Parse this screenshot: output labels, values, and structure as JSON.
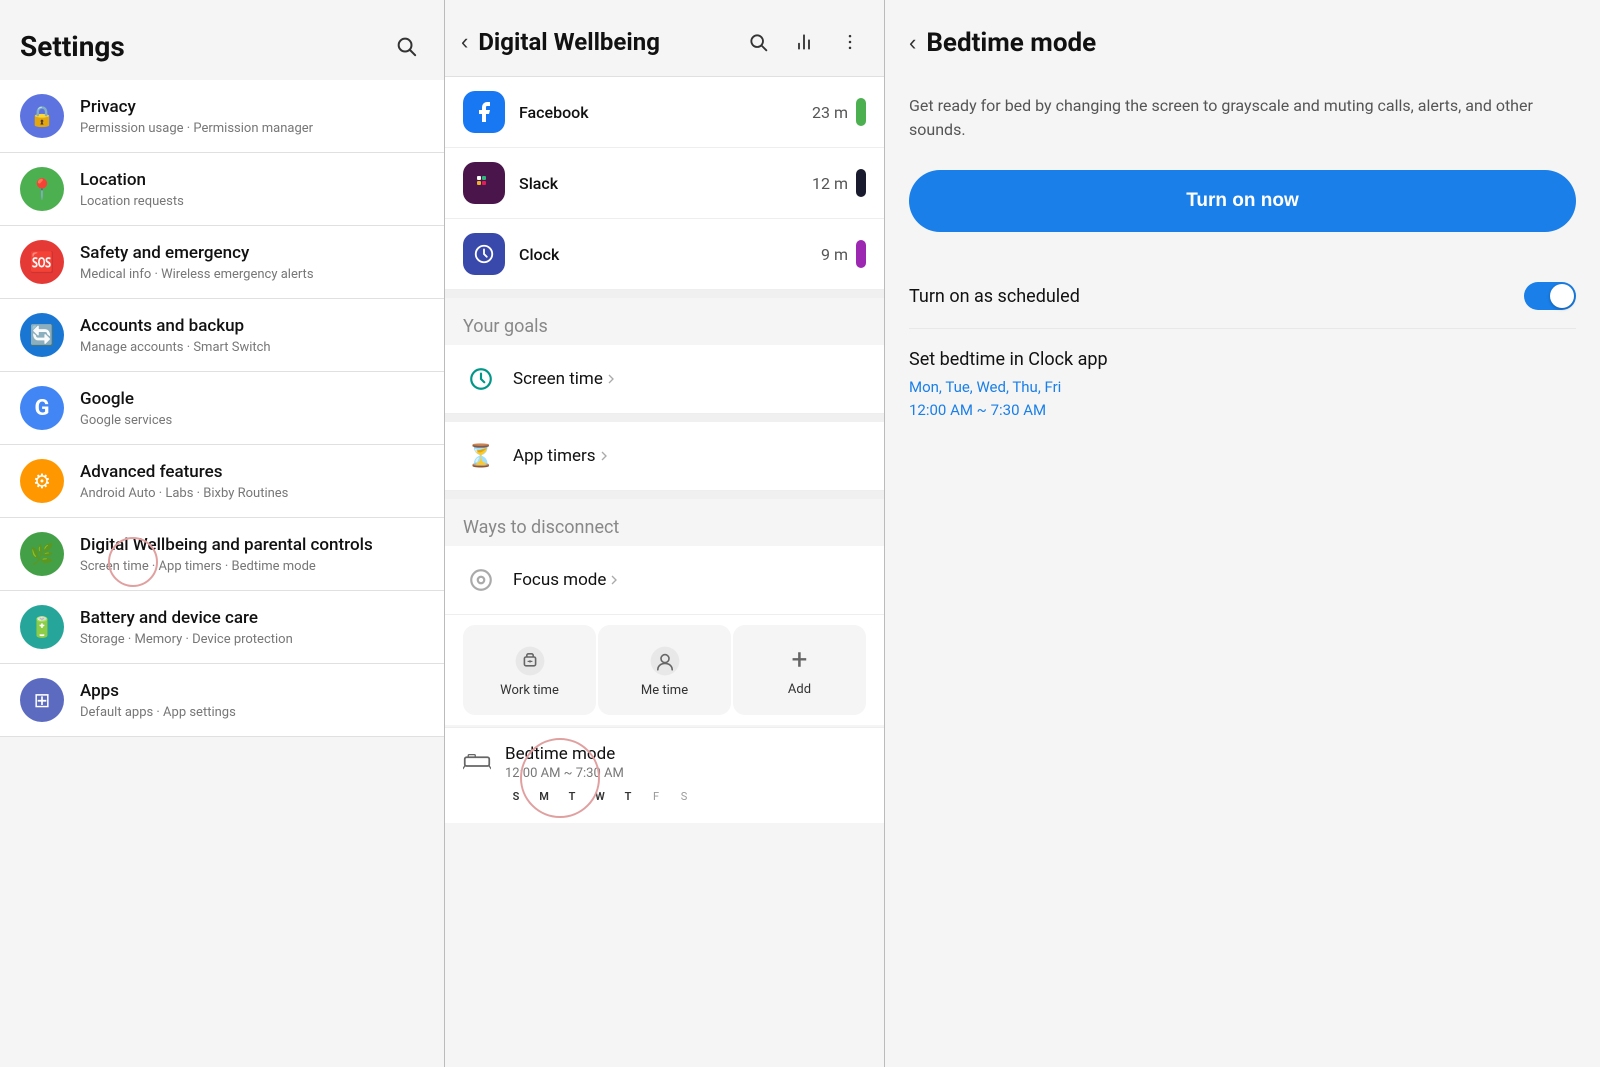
{
  "panel1": {
    "title": "Settings",
    "items": [
      {
        "id": "privacy",
        "label": "Privacy",
        "sublabel": "Permission usage · Permission manager",
        "icon_color": "#5c73e0",
        "icon": "🔒"
      },
      {
        "id": "location",
        "label": "Location",
        "sublabel": "Location requests",
        "icon_color": "#4caf50",
        "icon": "📍"
      },
      {
        "id": "safety",
        "label": "Safety and emergency",
        "sublabel": "Medical info · Wireless emergency alerts",
        "icon_color": "#e53935",
        "icon": "🆘"
      },
      {
        "id": "accounts",
        "label": "Accounts and backup",
        "sublabel": "Manage accounts · Smart Switch",
        "icon_color": "#1976d2",
        "icon": "🔄"
      },
      {
        "id": "google",
        "label": "Google",
        "sublabel": "Google services",
        "icon_color": "#4285f4",
        "icon": "G"
      },
      {
        "id": "advanced",
        "label": "Advanced features",
        "sublabel": "Android Auto · Labs · Bixby Routines",
        "icon_color": "#ff9800",
        "icon": "⚙"
      },
      {
        "id": "digital",
        "label": "Digital Wellbeing and parental controls",
        "sublabel": "Screen time · App timers · Bedtime mode",
        "icon_color": "#43a047",
        "icon": "🌿"
      },
      {
        "id": "battery",
        "label": "Battery and device care",
        "sublabel": "Storage · Memory · Device protection",
        "icon_color": "#26a69a",
        "icon": "🔋"
      },
      {
        "id": "apps",
        "label": "Apps",
        "sublabel": "Default apps · App settings",
        "icon_color": "#5c6bc0",
        "icon": "⊞"
      }
    ]
  },
  "panel2": {
    "title": "Digital Wellbeing",
    "back_label": "‹",
    "apps": [
      {
        "name": "Facebook",
        "time": "23 m",
        "bar_color": "#4caf50",
        "icon": "f",
        "icon_bg": "#1877f2"
      },
      {
        "name": "Slack",
        "time": "12 m",
        "bar_color": "#1a1a2e",
        "icon": "S",
        "icon_bg": "#4a154b"
      },
      {
        "name": "Clock",
        "time": "9 m",
        "bar_color": "#9c27b0",
        "icon": "🕐",
        "icon_bg": "#5c6bc0"
      }
    ],
    "goals_label": "Your goals",
    "goals": [
      {
        "id": "screen-time",
        "label": "Screen time",
        "icon": "⏱"
      }
    ],
    "app_timers_label": "App timers",
    "disconnect_label": "Ways to disconnect",
    "focus_mode_label": "Focus mode",
    "focus_cards": [
      {
        "label": "Work time",
        "icon": "💼"
      },
      {
        "label": "Me time",
        "icon": "😊"
      },
      {
        "label": "Add",
        "icon": "+"
      }
    ],
    "bedtime_label": "Bedtime mode",
    "bedtime_time": "12:00 AM ~ 7:30 AM",
    "bedtime_days": "S M T W T F S",
    "bedtime_days_array": [
      "S",
      "M",
      "T",
      "W",
      "T",
      "F",
      "S"
    ],
    "bedtime_active_days": [
      1,
      1,
      1,
      1,
      1,
      0,
      0
    ]
  },
  "panel3": {
    "title": "Bedtime mode",
    "back_label": "‹",
    "description": "Get ready for bed by changing the screen to grayscale and muting calls, alerts, and other sounds.",
    "turn_on_label": "Turn on now",
    "schedule_label": "Turn on as scheduled",
    "schedule_enabled": true,
    "clock_label": "Set bedtime in Clock app",
    "clock_days": "Mon, Tue, Wed, Thu, Fri",
    "clock_time": "12:00 AM ~ 7:30 AM"
  }
}
